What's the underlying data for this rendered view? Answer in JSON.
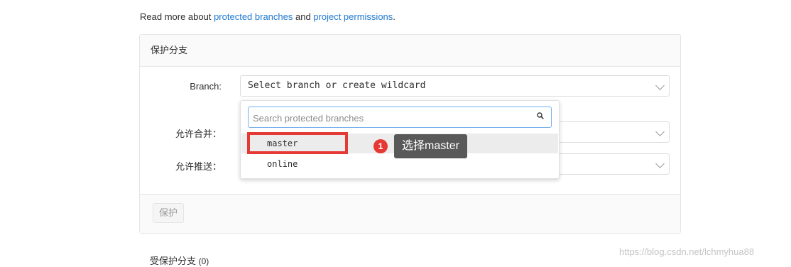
{
  "intro": {
    "prefix": "Read more about ",
    "link1": "protected branches",
    "middle": " and ",
    "link2": "project permissions",
    "suffix": "."
  },
  "panel": {
    "title": "保护分支",
    "branch_label": "Branch:",
    "branch_select_value": "Select branch or create wildcard",
    "merge_label": "允许合并：",
    "push_label": "允许推送：",
    "protect_button": "保护"
  },
  "dropdown": {
    "search_placeholder": "Search protected branches",
    "items": [
      "master",
      "online"
    ],
    "active_index": 0
  },
  "annotation": {
    "step_number": "1",
    "tooltip": "选择master",
    "highlight_color": "#e53935"
  },
  "protected_list": {
    "title": "受保护分支",
    "count": "(0)"
  },
  "watermark": "https://blog.csdn.net/lchmyhua88",
  "colors": {
    "link": "#1f78d1",
    "search_focus_border": "#73afea",
    "tooltip_bg": "#595959"
  }
}
